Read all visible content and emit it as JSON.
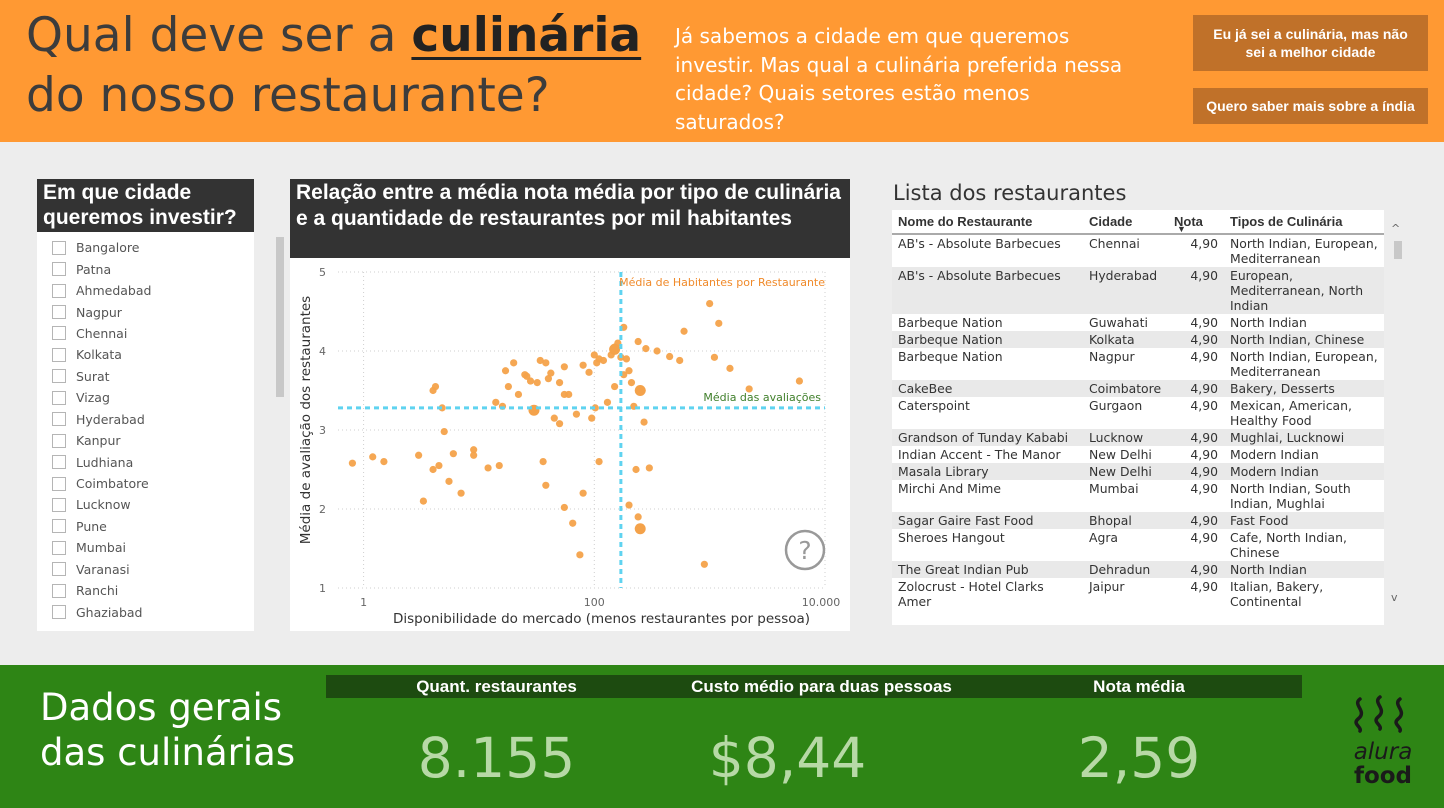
{
  "header": {
    "title_pre": "Qual deve ser a ",
    "title_emph": "culinária",
    "title_post": "do nosso restaurante?",
    "subtitle": "Já sabemos a cidade em que queremos investir. Mas qual a culinária preferida nessa cidade? Quais setores estão menos saturados?",
    "btn_city": "Eu já sei a culinária, mas não sei a melhor cidade",
    "btn_india": "Quero saber mais sobre a índia",
    "bg_color": "#ff9933"
  },
  "slicer": {
    "title": "Em que cidade queremos investir?",
    "cities": [
      "Bangalore",
      "Patna",
      "Ahmedabad",
      "Nagpur",
      "Chennai",
      "Kolkata",
      "Surat",
      "Vizag",
      "Hyderabad",
      "Kanpur",
      "Ludhiana",
      "Coimbatore",
      "Lucknow",
      "Pune",
      "Mumbai",
      "Varanasi",
      "Ranchi",
      "Ghaziabad"
    ]
  },
  "chart_data": {
    "type": "scatter",
    "title": "Relação entre a média nota média por tipo de culinária e a quantidade de restaurantes por mil habitantes",
    "xlabel": "Disponibilidade do mercado (menos restaurantes por pessoa)",
    "ylabel": "Média de avaliação dos restaurantes",
    "x_scale": "log",
    "xlim": [
      0.6,
      10000
    ],
    "ylim": [
      1,
      5
    ],
    "x_ticks": [
      "1",
      "100",
      "10.000"
    ],
    "y_ticks": [
      "1",
      "2",
      "3",
      "4",
      "5"
    ],
    "reference_lines": {
      "x_label": "Média de Habitantes por Restaurante",
      "x_value": 170,
      "y_label": "Média das avaliações",
      "y_value": 3.28
    },
    "help_icon": "question-icon",
    "point_color": "#f4a24a",
    "ref_line_color": "#5fd3f0",
    "points": [
      [
        0.8,
        2.58
      ],
      [
        1.2,
        2.66
      ],
      [
        1.5,
        2.6
      ],
      [
        3.0,
        2.68
      ],
      [
        3.3,
        2.1
      ],
      [
        4.0,
        2.5
      ],
      [
        4.0,
        3.5
      ],
      [
        4.2,
        3.55
      ],
      [
        4.5,
        2.55
      ],
      [
        4.8,
        3.28
      ],
      [
        5.0,
        2.98
      ],
      [
        5.5,
        2.35
      ],
      [
        6.0,
        2.7
      ],
      [
        7.0,
        2.2
      ],
      [
        9.0,
        2.75
      ],
      [
        9.0,
        2.68
      ],
      [
        12.0,
        2.52
      ],
      [
        14.0,
        3.35
      ],
      [
        15.0,
        2.55
      ],
      [
        16.0,
        3.3
      ],
      [
        17.0,
        3.75
      ],
      [
        18.0,
        3.55
      ],
      [
        20.0,
        3.85
      ],
      [
        22.0,
        3.45
      ],
      [
        25.0,
        3.7
      ],
      [
        26.0,
        3.68
      ],
      [
        28.0,
        3.62
      ],
      [
        30.0,
        3.25
      ],
      [
        32.0,
        3.6
      ],
      [
        34.0,
        3.88
      ],
      [
        36.0,
        2.6
      ],
      [
        38.0,
        3.85
      ],
      [
        38.0,
        2.3
      ],
      [
        40.0,
        3.65
      ],
      [
        42.0,
        3.72
      ],
      [
        45.0,
        3.15
      ],
      [
        50.0,
        3.08
      ],
      [
        50.0,
        3.6
      ],
      [
        55.0,
        3.45
      ],
      [
        55.0,
        3.8
      ],
      [
        55.0,
        2.02
      ],
      [
        60.0,
        3.45
      ],
      [
        65.0,
        1.82
      ],
      [
        70.0,
        3.2
      ],
      [
        75.0,
        1.42
      ],
      [
        80.0,
        3.82
      ],
      [
        80.0,
        2.2
      ],
      [
        90.0,
        3.73
      ],
      [
        95.0,
        3.15
      ],
      [
        100.0,
        3.95
      ],
      [
        102.0,
        3.28
      ],
      [
        105.0,
        3.85
      ],
      [
        110.0,
        3.9
      ],
      [
        110.0,
        2.6
      ],
      [
        120.0,
        3.88
      ],
      [
        130.0,
        3.35
      ],
      [
        140.0,
        3.95
      ],
      [
        150.0,
        4.05
      ],
      [
        150.0,
        3.55
      ],
      [
        160.0,
        4.1
      ],
      [
        170.0,
        3.92
      ],
      [
        180.0,
        4.3
      ],
      [
        180.0,
        3.7
      ],
      [
        190.0,
        3.9
      ],
      [
        200.0,
        3.75
      ],
      [
        200.0,
        2.05
      ],
      [
        210.0,
        3.6
      ],
      [
        220.0,
        3.3
      ],
      [
        230.0,
        2.5
      ],
      [
        240.0,
        4.12
      ],
      [
        240.0,
        1.9
      ],
      [
        250.0,
        1.75
      ],
      [
        260.0,
        3.5
      ],
      [
        270.0,
        3.1
      ],
      [
        280.0,
        4.03
      ],
      [
        300.0,
        2.52
      ],
      [
        350.0,
        4.0
      ],
      [
        450.0,
        3.93
      ],
      [
        550.0,
        3.88
      ],
      [
        600.0,
        4.25
      ],
      [
        900.0,
        1.3
      ],
      [
        1000.0,
        4.6
      ],
      [
        1100.0,
        3.92
      ],
      [
        1200.0,
        4.35
      ],
      [
        1500.0,
        3.78
      ],
      [
        2200.0,
        3.52
      ],
      [
        6000.0,
        3.62
      ]
    ],
    "big_points": [
      [
        150.0,
        4.02
      ],
      [
        250.0,
        1.75
      ],
      [
        250.0,
        3.5
      ],
      [
        30.0,
        3.25
      ]
    ]
  },
  "table": {
    "title": "Lista dos restaurantes",
    "columns": [
      "Nome do Restaurante",
      "Cidade",
      "Nota",
      "Tipos de Culinária"
    ],
    "rows": [
      [
        "AB's - Absolute Barbecues",
        "Chennai",
        "4,90",
        "North Indian, European, Mediterranean"
      ],
      [
        "AB's - Absolute Barbecues",
        "Hyderabad",
        "4,90",
        "European, Mediterranean, North Indian"
      ],
      [
        "Barbeque Nation",
        "Guwahati",
        "4,90",
        "North Indian"
      ],
      [
        "Barbeque Nation",
        "Kolkata",
        "4,90",
        "North Indian, Chinese"
      ],
      [
        "Barbeque Nation",
        "Nagpur",
        "4,90",
        "North Indian, European, Mediterranean"
      ],
      [
        "CakeBee",
        "Coimbatore",
        "4,90",
        "Bakery, Desserts"
      ],
      [
        "Caterspoint",
        "Gurgaon",
        "4,90",
        "Mexican, American, Healthy Food"
      ],
      [
        "Grandson of Tunday Kababi",
        "Lucknow",
        "4,90",
        "Mughlai, Lucknowi"
      ],
      [
        "Indian Accent - The Manor",
        "New Delhi",
        "4,90",
        "Modern Indian"
      ],
      [
        "Masala Library",
        "New Delhi",
        "4,90",
        "Modern Indian"
      ],
      [
        "Mirchi And Mime",
        "Mumbai",
        "4,90",
        "North Indian, South Indian, Mughlai"
      ],
      [
        "Sagar Gaire Fast Food",
        "Bhopal",
        "4,90",
        "Fast Food"
      ],
      [
        "Sheroes Hangout",
        "Agra",
        "4,90",
        "Cafe, North Indian, Chinese"
      ],
      [
        "The Great Indian Pub",
        "Dehradun",
        "4,90",
        "North Indian"
      ],
      [
        "Zolocrust - Hotel Clarks Amer",
        "Jaipur",
        "4,90",
        "Italian, Bakery, Continental"
      ]
    ]
  },
  "footer": {
    "title": "Dados gerais das culinárias",
    "kpis": [
      {
        "label": "Quant. restaurantes",
        "value": "8.155"
      },
      {
        "label": "Custo médio para duas pessoas",
        "value": "$8,44"
      },
      {
        "label": "Nota média",
        "value": "2,59"
      }
    ],
    "logo_top": "alura",
    "logo_bottom": "food",
    "bg_color": "#2e8515"
  }
}
